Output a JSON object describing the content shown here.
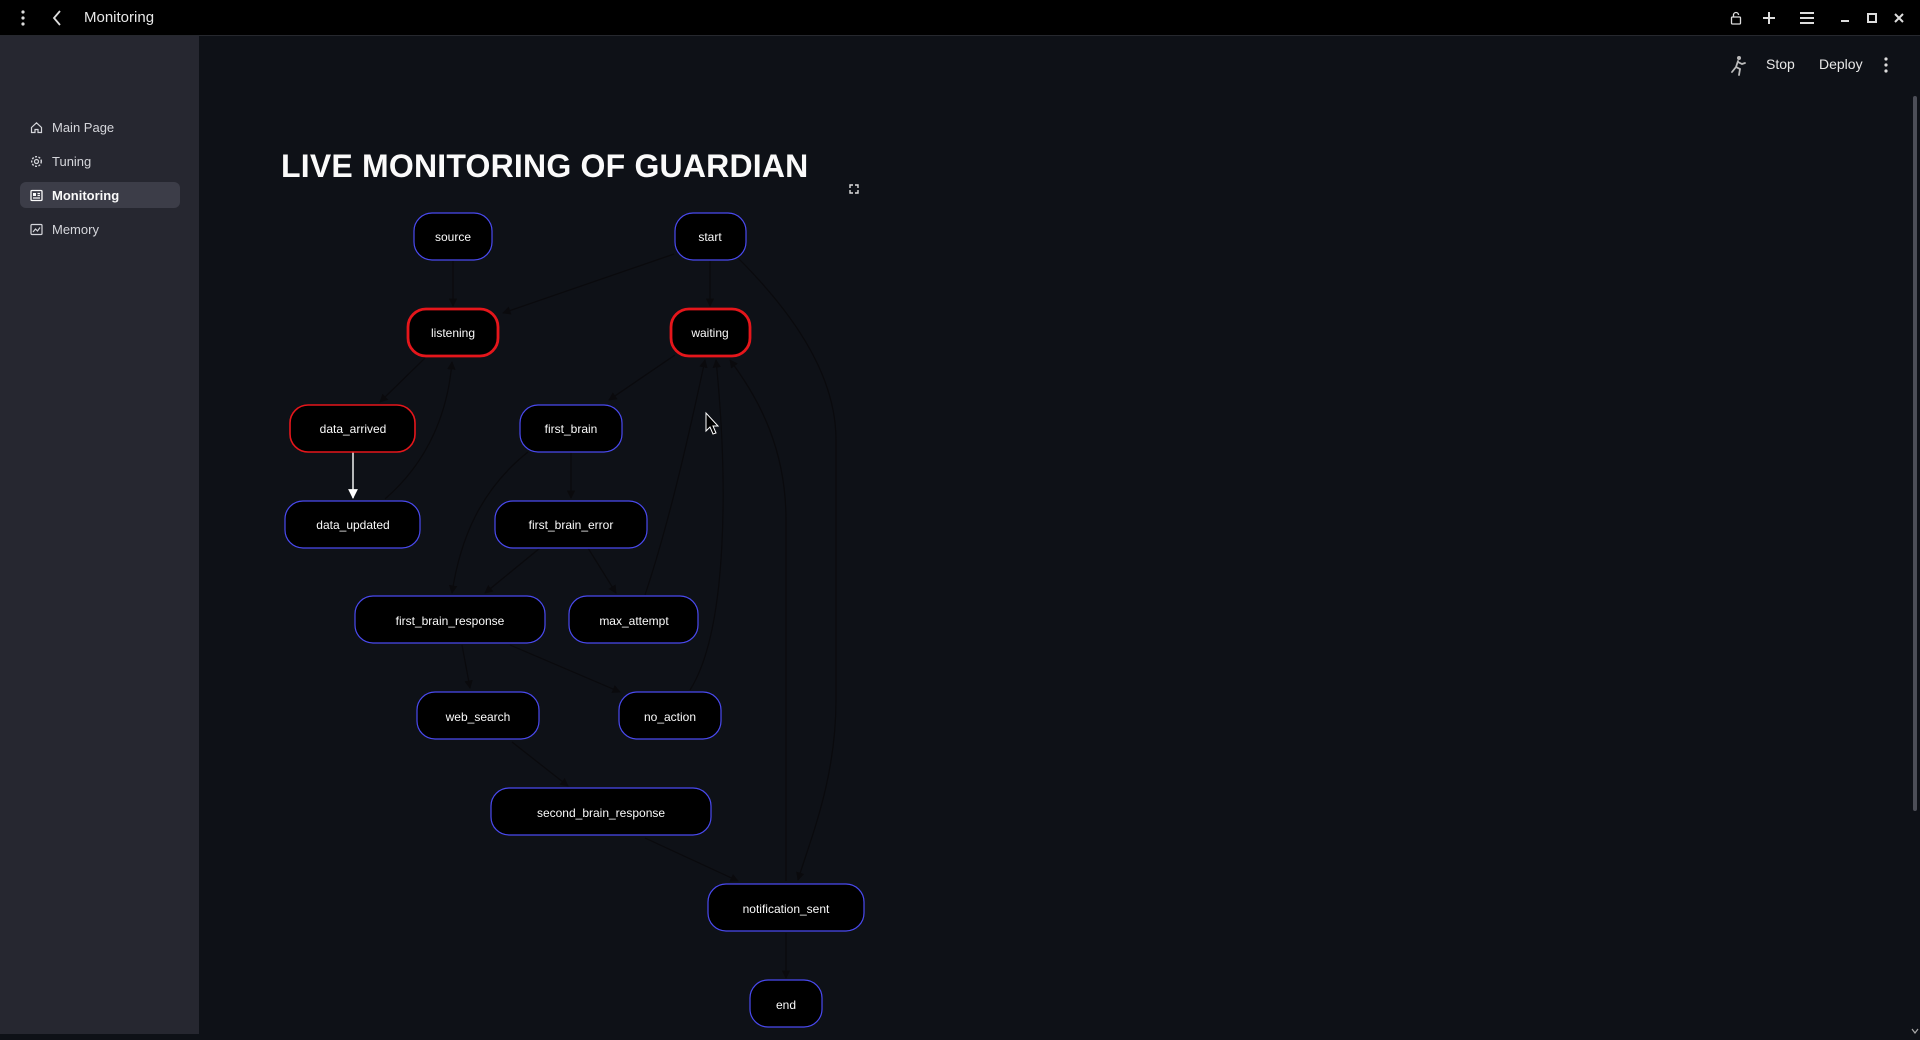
{
  "window": {
    "title": "Monitoring"
  },
  "sidebar": {
    "items": [
      {
        "label": "Main Page",
        "icon": "home-icon",
        "active": false
      },
      {
        "label": "Tuning",
        "icon": "gear-icon",
        "active": false
      },
      {
        "label": "Monitoring",
        "icon": "dashboard-icon",
        "active": true
      },
      {
        "label": "Memory",
        "icon": "memory-icon",
        "active": false
      }
    ]
  },
  "header": {
    "stop_label": "Stop",
    "deploy_label": "Deploy"
  },
  "main": {
    "title": "LIVE MONITORING OF GUARDIAN"
  },
  "graph": {
    "nodes": {
      "source": "source",
      "start": "start",
      "listening": "listening",
      "waiting": "waiting",
      "data_arrived": "data_arrived",
      "first_brain": "first_brain",
      "data_updated": "data_updated",
      "first_brain_error": "first_brain_error",
      "first_brain_response": "first_brain_response",
      "max_attempt": "max_attempt",
      "web_search": "web_search",
      "no_action": "no_action",
      "second_brain_response": "second_brain_response",
      "notification_sent": "notification_sent",
      "end": "end"
    },
    "active_nodes": [
      "listening",
      "waiting",
      "data_arrived"
    ]
  },
  "colors": {
    "background": "#0e1117",
    "sidebar": "#262730",
    "node_border": "#4a4af0",
    "active_border": "#e5161b"
  }
}
